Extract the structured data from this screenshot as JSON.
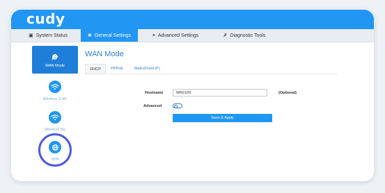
{
  "brand": {
    "logo_text": "cudy"
  },
  "tabs": {
    "system_status": "System Status",
    "general_settings": "General Settings",
    "advanced_settings": "Advanced Settings",
    "diagnostic_tools": "Diagnostic Tools",
    "active": "general_settings"
  },
  "sidebar": {
    "items": [
      {
        "label": "WAN Mode",
        "icon": "wan-icon",
        "active": true
      },
      {
        "label": "Wireless 2.4G",
        "icon": "wifi-icon",
        "active": false
      },
      {
        "label": "Wireless 5G",
        "icon": "wifi-icon",
        "active": false
      },
      {
        "label": "VPN",
        "icon": "globe-icon",
        "active": false,
        "highlighted": true
      }
    ]
  },
  "main": {
    "title": "WAN Mode",
    "subtabs": [
      "DHCP",
      "PPPoE",
      "Static(Fixed IP)"
    ],
    "active_subtab": "DHCP",
    "hostname_label": "Hostname",
    "hostname_value": "WR2100",
    "optional_label": "(Optional)",
    "advanced_label": "Advanced",
    "advanced_enabled": false,
    "save_button": "Save & Apply"
  },
  "colors": {
    "brand_blue": "#2196f3",
    "highlight_ring": "#4a59e0",
    "link_blue": "#2a7fd4"
  }
}
